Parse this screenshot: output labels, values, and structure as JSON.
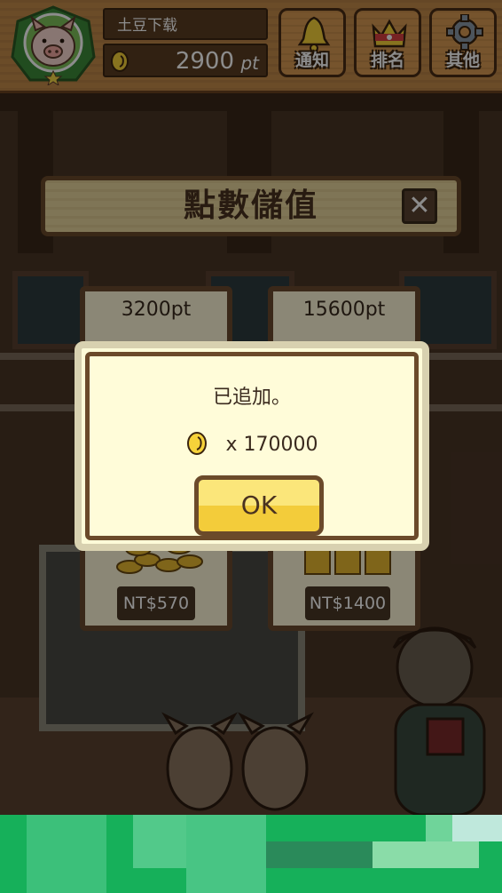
{
  "header": {
    "username": "土豆下载",
    "points": "2900",
    "points_unit": "pt",
    "buttons": [
      {
        "label": "通知",
        "icon": "bell-icon"
      },
      {
        "label": "排名",
        "icon": "crown-icon"
      },
      {
        "label": "其他",
        "icon": "gear-icon"
      }
    ]
  },
  "panel": {
    "title": "點數儲值",
    "close": "✕"
  },
  "cards": [
    {
      "points": "3200pt",
      "price": "NT$570"
    },
    {
      "points": "15600pt",
      "price": "NT$1400"
    }
  ],
  "dialog": {
    "message": "已追加。",
    "amount": "x 170000",
    "ok_label": "OK"
  },
  "colors": {
    "header_wood": "#c48a4a",
    "panel": "#e8d59d",
    "ok_button": "#f6d64a",
    "ad_green": "#16b05a"
  }
}
